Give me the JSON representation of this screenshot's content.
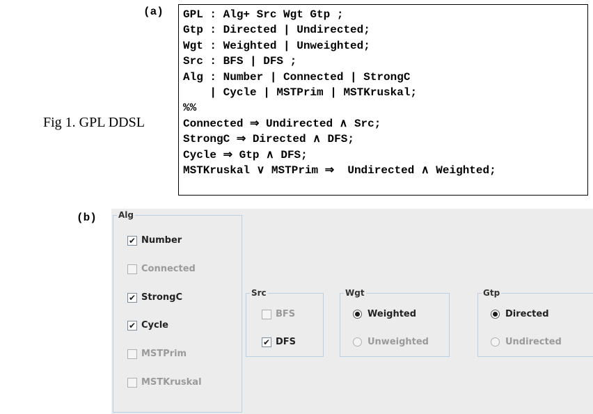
{
  "figure": {
    "caption": "Fig 1.  GPL DDSL",
    "label_a": "(a)",
    "label_b": "(b)"
  },
  "grammar": {
    "lines": [
      "GPL : Alg+ Src Wgt Gtp ;",
      "Gtp : Directed | Undirected;",
      "Wgt : Weighted | Unweighted;",
      "Src : BFS | DFS ;",
      "Alg : Number | Connected | StrongC",
      "    | Cycle | MSTPrim | MSTKruskal;",
      "%%",
      "Connected ⇒ Undirected ∧ Src;",
      "StrongC ⇒ Directed ∧ DFS;",
      "Cycle ⇒ Gtp ∧ DFS;",
      "MSTKruskal ∨ MSTPrim ⇒  Undirected ∧ Weighted;"
    ]
  },
  "gui": {
    "alg": {
      "title": "Alg",
      "options": [
        {
          "label": "Number",
          "checked": true,
          "enabled": true
        },
        {
          "label": "Connected",
          "checked": false,
          "enabled": false
        },
        {
          "label": "StrongC",
          "checked": true,
          "enabled": true
        },
        {
          "label": "Cycle",
          "checked": true,
          "enabled": true
        },
        {
          "label": "MSTPrim",
          "checked": false,
          "enabled": false
        },
        {
          "label": "MSTKruskal",
          "checked": false,
          "enabled": false
        }
      ]
    },
    "src": {
      "title": "Src",
      "options": [
        {
          "label": "BFS",
          "checked": false,
          "enabled": false
        },
        {
          "label": "DFS",
          "checked": true,
          "enabled": true
        }
      ]
    },
    "wgt": {
      "title": "Wgt",
      "options": [
        {
          "label": "Weighted",
          "selected": true,
          "enabled": true
        },
        {
          "label": "Unweighted",
          "selected": false,
          "enabled": false
        }
      ]
    },
    "gtp": {
      "title": "Gtp",
      "options": [
        {
          "label": "Directed",
          "selected": true,
          "enabled": true
        },
        {
          "label": "Undirected",
          "selected": false,
          "enabled": false
        }
      ]
    }
  },
  "colors": {
    "panel_bg": "#ececec",
    "group_border": "#b8cfe5",
    "enabled_text": "#222222",
    "disabled_text": "#9a9a9a"
  }
}
